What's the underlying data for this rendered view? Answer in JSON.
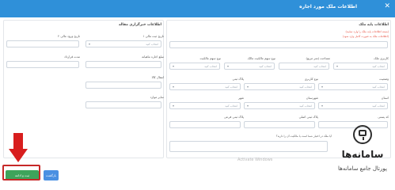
{
  "window": {
    "title": "اطلاعات ملک مورد اجاره",
    "close_icon": "close-icon"
  },
  "left_panel": {
    "section_title": "اطلاعات خبرگزاری مقاله",
    "fields": [
      {
        "label": "تاریخ ورود مالی ۲",
        "placeholder": ""
      },
      {
        "label": "تاریخ ثبت مالی ۱",
        "placeholder": "انتخاب کنید"
      },
      {
        "label": "مدت قرارداد",
        "placeholder": ""
      },
      {
        "label": "مبلغ اجاره ماهیانه",
        "placeholder": ""
      },
      {
        "label": "انتقال کالا",
        "placeholder": ""
      },
      {
        "label": "سایر موارد",
        "placeholder": ""
      }
    ]
  },
  "right_panel": {
    "section_title": "اطلاعات پایه ملک",
    "warning_1": "(بسته اطلاعات پایه ملک را وارد نمایید)",
    "warning_2": "(اطلاعات ملک به صورت کامل وارد شود)",
    "rows": [
      [
        {
          "label": "نوع سهم مالکیت",
          "placeholder": "انتخاب کنید"
        },
        {
          "label": "نوع سهم مالکیت مالک",
          "placeholder": "انتخاب کنید"
        },
        {
          "label": "مساحت (متر مربع)",
          "placeholder": "انتخاب کنید"
        },
        {
          "label": "کاربری ملک",
          "placeholder": "انتخاب کنید"
        }
      ],
      [
        {
          "label": "پلاک ثبتی",
          "placeholder": "انتخاب کنید"
        },
        {
          "label": "نوع کاربری",
          "placeholder": "انتخاب کنید"
        },
        {
          "label": "وضعیت",
          "placeholder": "انتخاب کنید"
        }
      ],
      [
        {
          "label": "شهر",
          "placeholder": "انتخاب کنید"
        },
        {
          "label": "شهرستان",
          "placeholder": "انتخاب کنید"
        },
        {
          "label": "استان",
          "placeholder": "انتخاب کنید"
        }
      ],
      [
        {
          "label": "پلاک ثبتی فرعی",
          "placeholder": ""
        },
        {
          "label": "پلاک ثبتی اصلی",
          "placeholder": ""
        },
        {
          "label": "کد پستی",
          "placeholder": ""
        }
      ]
    ],
    "note": "آیا ملک در اختیار شما است یا مالکیت آن را دارید؟",
    "address_placeholder": ""
  },
  "footer": {
    "register_label": "ثبت و ادامه",
    "back_label": "بازگشت"
  },
  "watermark": "Activate Windows",
  "logo": {
    "name": "سامانه‌ها",
    "subtitle": "پورتال جامع سامانه‌ها",
    "icon": "monitor-icon"
  },
  "annotation_arrow": "arrow-down-icon"
}
